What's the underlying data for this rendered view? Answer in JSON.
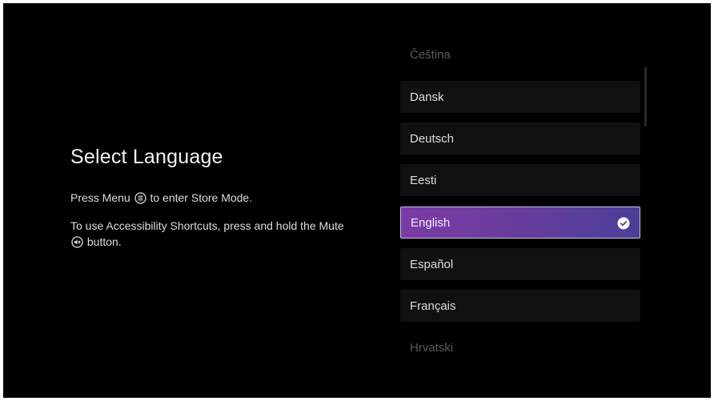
{
  "page": {
    "title": "Select Language",
    "menu_hint_before": "Press Menu",
    "menu_hint_after": "to enter Store Mode.",
    "accessibility_hint_before": "To use Accessibility Shortcuts, press and hold the Mute",
    "accessibility_hint_after": "button.",
    "menu_icon": "menu-button-icon",
    "mute_icon": "mute-button-icon"
  },
  "languages": {
    "items": [
      {
        "label": "Čeština"
      },
      {
        "label": "Dansk"
      },
      {
        "label": "Deutsch"
      },
      {
        "label": "Eesti"
      },
      {
        "label": "English"
      },
      {
        "label": "Español"
      },
      {
        "label": "Français"
      },
      {
        "label": "Hrvatski"
      }
    ],
    "selected": "English"
  },
  "colors": {
    "background": "#000000",
    "item_background": "#101010",
    "selected_start": "#7b3ba6",
    "selected_end": "#4b3f98",
    "selected_border": "#cbbde6",
    "text": "#dedede"
  }
}
